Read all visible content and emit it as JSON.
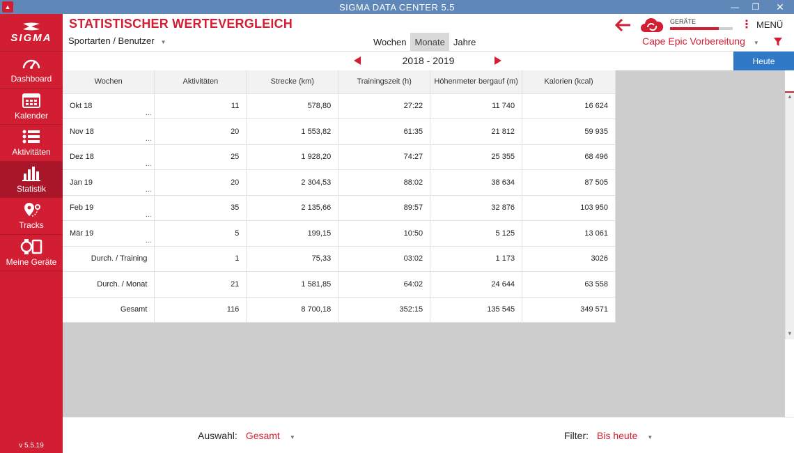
{
  "window": {
    "title": "SIGMA DATA CENTER 5.5",
    "controls": {
      "minimize": "—",
      "restore": "❐",
      "close": "✕"
    }
  },
  "sidebar": {
    "logo_text": "SIGMA",
    "items": [
      {
        "label": "Dashboard",
        "icon": "gauge-icon",
        "active": false
      },
      {
        "label": "Kalender",
        "icon": "calendar-icon",
        "active": false
      },
      {
        "label": "Aktivitäten",
        "icon": "list-icon",
        "active": false
      },
      {
        "label": "Statistik",
        "icon": "bar-chart-icon",
        "active": true
      },
      {
        "label": "Tracks",
        "icon": "map-pin-icon",
        "active": false
      },
      {
        "label": "Meine Geräte",
        "icon": "devices-icon",
        "active": false
      }
    ],
    "version": "v 5.5.19"
  },
  "header": {
    "title": "STATISTISCHER WERTEVERGLEICH",
    "sport_selector": "Sportarten / Benutzer",
    "period_tabs": [
      {
        "label": "Wochen",
        "active": false
      },
      {
        "label": "Monate",
        "active": true
      },
      {
        "label": "Jahre",
        "active": false
      }
    ],
    "devices_label": "GERÄTE",
    "devices_progress": 0.78,
    "menu_label": "MENÜ",
    "profile": "Cape Epic Vorbereitung"
  },
  "colors": {
    "brand": "#d21e32",
    "accent_blue": "#2f79c6",
    "titlebar": "#5f87b8"
  },
  "year_nav": {
    "label": "2018 - 2019",
    "today_button": "Heute"
  },
  "table": {
    "headers": [
      "Wochen",
      "Aktivitäten",
      "Strecke (km)",
      "Trainingszeit (h)",
      "Höhenmeter bergauf (m)",
      "Kalorien (kcal)"
    ],
    "rows": [
      {
        "period": "Okt 18",
        "activities": "11",
        "distance": "578,80",
        "time": "27:22",
        "elevation": "11 740",
        "calories": "16 624"
      },
      {
        "period": "Nov 18",
        "activities": "20",
        "distance": "1 553,82",
        "time": "61:35",
        "elevation": "21 812",
        "calories": "59 935"
      },
      {
        "period": "Dez 18",
        "activities": "25",
        "distance": "1 928,20",
        "time": "74:27",
        "elevation": "25 355",
        "calories": "68 496"
      },
      {
        "period": "Jan 19",
        "activities": "20",
        "distance": "2 304,53",
        "time": "88:02",
        "elevation": "38 634",
        "calories": "87 505"
      },
      {
        "period": "Feb 19",
        "activities": "35",
        "distance": "2 135,66",
        "time": "89:57",
        "elevation": "32 876",
        "calories": "103 950"
      },
      {
        "period": "Mär 19",
        "activities": "5",
        "distance": "199,15",
        "time": "10:50",
        "elevation": "5 125",
        "calories": "13 061"
      }
    ],
    "more_marker": "...",
    "summary": [
      {
        "label": "Durch. / Training",
        "activities": "1",
        "distance": "75,33",
        "time": "03:02",
        "elevation": "1 173",
        "calories": "3026"
      },
      {
        "label": "Durch. / Monat",
        "activities": "21",
        "distance": "1 581,85",
        "time": "64:02",
        "elevation": "24 644",
        "calories": "63 558"
      },
      {
        "label": "Gesamt",
        "activities": "116",
        "distance": "8 700,18",
        "time": "352:15",
        "elevation": "135 545",
        "calories": "349 571"
      }
    ]
  },
  "footer": {
    "selection_label": "Auswahl:",
    "selection_value": "Gesamt",
    "filter_label": "Filter:",
    "filter_value": "Bis heute"
  }
}
